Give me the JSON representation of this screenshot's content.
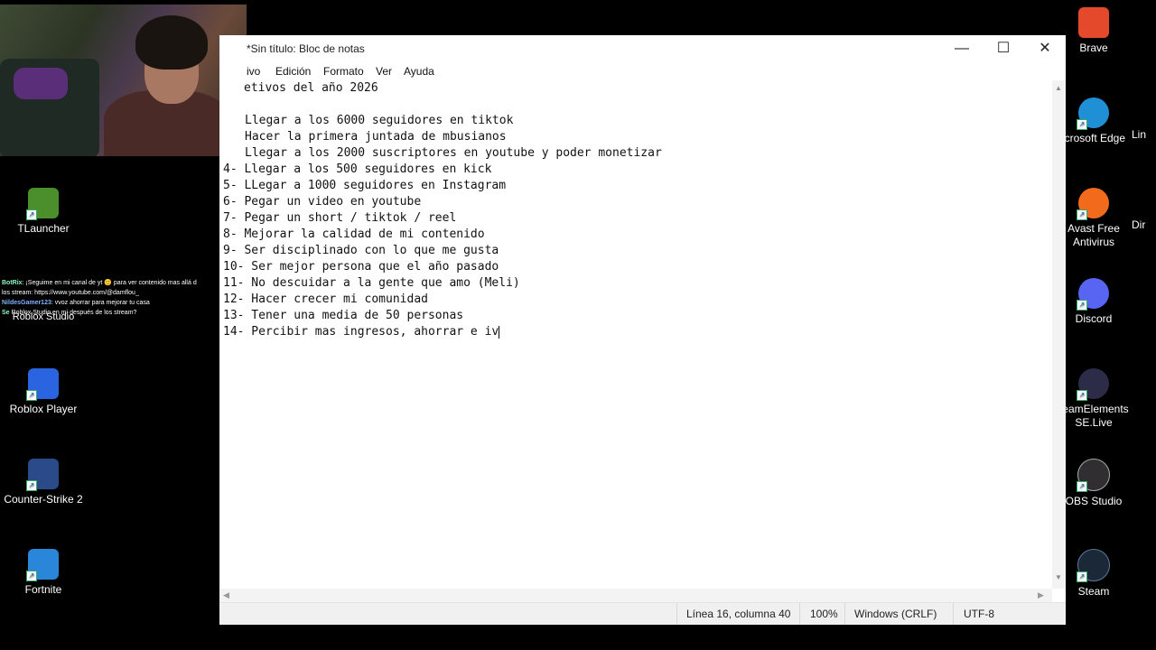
{
  "desktop_left": [
    {
      "label": "TLauncher",
      "color": "#4a8f2c"
    },
    {
      "label": "Roblox Studio",
      "color": "#2e6fd1"
    },
    {
      "label": "Roblox Player",
      "color": "#2b64e0"
    },
    {
      "label": "Counter-Strike 2",
      "color": "#2a4a8a"
    },
    {
      "label": "Fortnite",
      "color": "#2a86d8"
    }
  ],
  "desktop_right": [
    {
      "label": "Brave",
      "color": "#e3492a"
    },
    {
      "label": "icrosoft Edge",
      "color": "#1f8fd6"
    },
    {
      "label": "Avast Free Antivirus",
      "color": "#f26b1d"
    },
    {
      "label": "Discord",
      "color": "#5865f2"
    },
    {
      "label": "reamElements SE.Live",
      "color": "#2c2c48"
    },
    {
      "label": "OBS Studio",
      "color": "#302e31"
    },
    {
      "label": "Steam",
      "color": "#1b2838"
    }
  ],
  "desktop_edge": [
    "Lin",
    "Dir"
  ],
  "chat": [
    {
      "user": "BotRix",
      "text": ": ¡Seguime en mi canal de yt 🙂 para ver contenido mas allá d"
    },
    {
      "user": "",
      "text": "los stream: https://www.youtube.com/@damflou_"
    },
    {
      "user": "NildesGamer123",
      "text": ": vvoz ahorrar para mejorar tu casa"
    },
    {
      "user": "Se",
      "text": "Roblox Studio en mi después de los stream?"
    }
  ],
  "notepad": {
    "title": "*Sin título: Bloc de notas",
    "menu": [
      "ivo",
      "Edición",
      "Formato",
      "Ver",
      "Ayuda"
    ],
    "lines": [
      "etivos del año 2026",
      "",
      "Llegar a los 6000 seguidores en tiktok",
      "Hacer la primera juntada de mbusianos",
      "Llegar a los 2000 suscriptores en youtube y poder monetizar",
      "4- Llegar a los 500 seguidores en kick",
      "5- LLegar a 1000 seguidores en Instagram",
      "6- Pegar un video en youtube",
      "7- Pegar un short / tiktok / reel",
      "8- Mejorar la calidad de mi contenido",
      "9- Ser disciplinado con lo que me gusta",
      "10- Ser mejor persona que el año pasado",
      "11- No descuidar a la gente que amo (Meli)",
      "12- Hacer crecer mi comunidad",
      "13- Tener una media de 50 personas",
      "14- Percibir mas ingresos, ahorrar e iv"
    ],
    "status": {
      "position": "Línea 16, columna 40",
      "zoom": "100%",
      "line_ending": "Windows (CRLF)",
      "encoding": "UTF-8"
    },
    "buttons": {
      "minimize": "—",
      "maximize": "☐",
      "close": "✕"
    }
  }
}
